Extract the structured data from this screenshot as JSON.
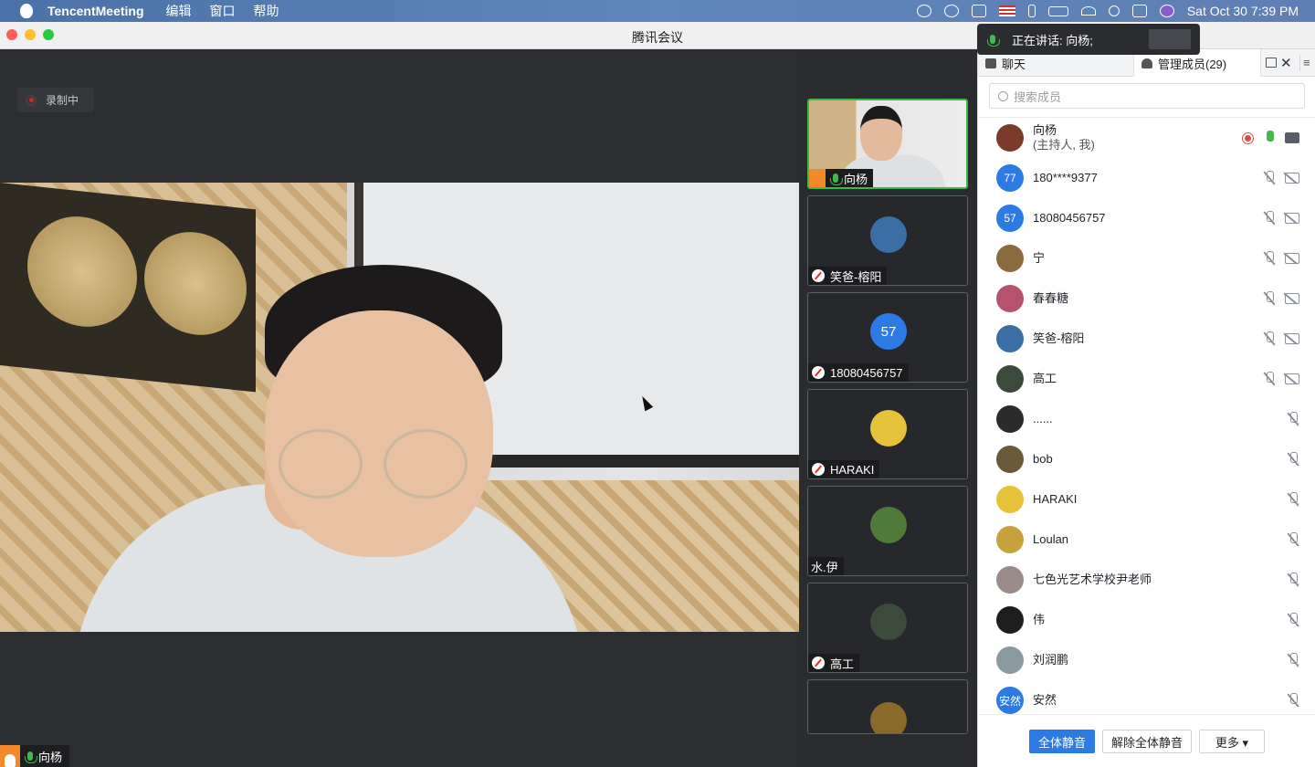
{
  "menubar": {
    "app_name": "TencentMeeting",
    "menus": [
      "编辑",
      "窗口",
      "帮助"
    ],
    "status_icons": [
      "screen-record-icon",
      "play-icon",
      "volume-icon",
      "us-flag-icon",
      "bluetooth-icon",
      "battery-icon",
      "wifi-icon",
      "spotlight-search-icon",
      "control-center-icon",
      "siri-icon"
    ],
    "datetime": "Sat Oct 30  7:39 PM"
  },
  "window": {
    "title": "腾讯会议"
  },
  "stage": {
    "recording_label": "录制中",
    "main_speaker_name": "向杨"
  },
  "speaking_banner": {
    "text": "正在讲话: 向杨;"
  },
  "gallery": [
    {
      "name": "向杨",
      "type": "video",
      "mic": "on",
      "host": true
    },
    {
      "name": "笑爸-榕阳",
      "type": "avatar",
      "mic": "muted",
      "color": "#3a6ea5"
    },
    {
      "name": "18080456757",
      "type": "initials",
      "initials": "57",
      "mic": "muted",
      "color": "#2c7be5"
    },
    {
      "name": "HARAKI",
      "type": "avatar",
      "mic": "muted",
      "color": "#e6c23a"
    },
    {
      "name": "水.伊",
      "type": "avatar",
      "mic": "none",
      "color": "#4f7a3a"
    },
    {
      "name": "高工",
      "type": "avatar",
      "mic": "muted",
      "color": "#3b4a3a"
    }
  ],
  "panel": {
    "tab_chat": "聊天",
    "tab_members": "管理成员(29)",
    "search_placeholder": "搜索成员",
    "members": [
      {
        "name": "向杨",
        "sub": "(主持人, 我)",
        "av": "",
        "color": "#7a3b2a",
        "rec": true,
        "mic": "on",
        "cam": "on"
      },
      {
        "name": "180****9377",
        "av": "77",
        "color": "#2c7be5",
        "mic": "muted",
        "cam": "off"
      },
      {
        "name": "18080456757",
        "av": "57",
        "color": "#2c7be5",
        "mic": "muted",
        "cam": "off"
      },
      {
        "name": "宁",
        "av": "",
        "color": "#8b6a3e",
        "mic": "muted",
        "cam": "off"
      },
      {
        "name": "春春糖",
        "av": "",
        "color": "#b5536f",
        "mic": "muted",
        "cam": "off"
      },
      {
        "name": "笑爸-榕阳",
        "av": "",
        "color": "#3a6ea5",
        "mic": "muted",
        "cam": "off"
      },
      {
        "name": "高工",
        "av": "",
        "color": "#3b4a3a",
        "mic": "muted",
        "cam": "off"
      },
      {
        "name": "......",
        "av": "",
        "color": "#2b2b2b",
        "mic": "muted"
      },
      {
        "name": "bob",
        "av": "",
        "color": "#6b5a3a",
        "mic": "muted"
      },
      {
        "name": "HARAKI",
        "av": "",
        "color": "#e6c23a",
        "mic": "muted"
      },
      {
        "name": "Loulan",
        "av": "",
        "color": "#c7a23a",
        "mic": "muted"
      },
      {
        "name": "七色光艺术学校尹老师",
        "av": "",
        "color": "#9a8a8a",
        "mic": "muted"
      },
      {
        "name": "伟",
        "av": "",
        "color": "#1e1e1e",
        "mic": "muted"
      },
      {
        "name": "刘润鹏",
        "av": "",
        "color": "#8a9aa0",
        "mic": "muted"
      },
      {
        "name": "安然",
        "av": "安然",
        "color": "#2c7be5",
        "mic": "muted"
      }
    ],
    "btn_mute_all": "全体静音",
    "btn_unmute_all": "解除全体静音",
    "btn_more": "更多 ▾"
  }
}
